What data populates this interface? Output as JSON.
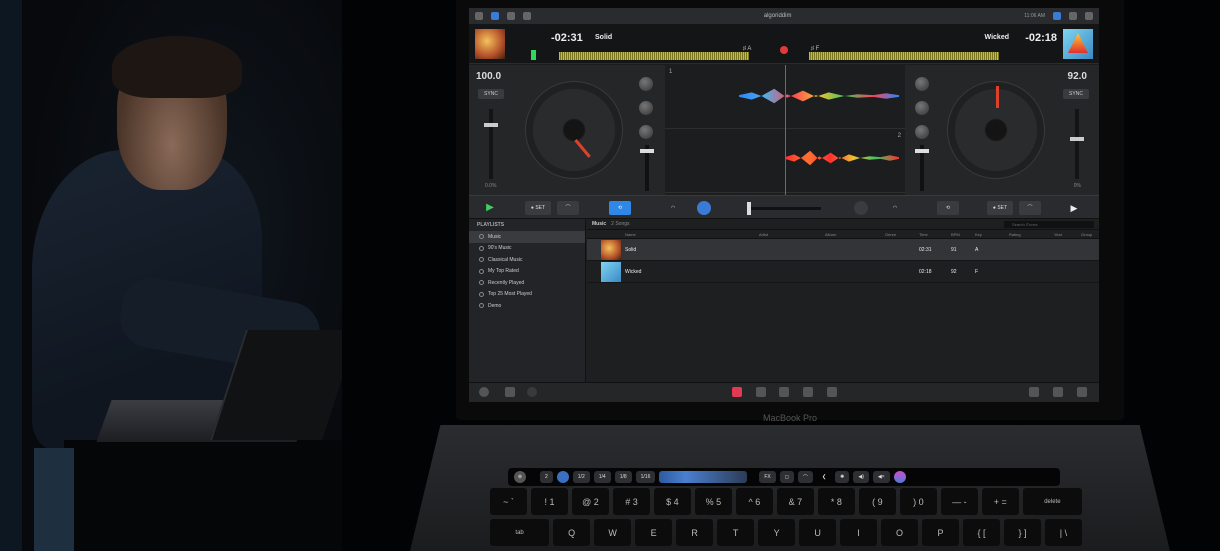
{
  "app": {
    "menubar": {
      "brand": "algoriddim",
      "time": "11:06 AM"
    },
    "deck_a": {
      "time": "-02:31",
      "title": "Solid",
      "key": "A",
      "bpm": "100.0",
      "sync": "SYNC",
      "pitch_value": "0.0%"
    },
    "deck_b": {
      "time": "-02:18",
      "title": "Wicked",
      "key": "F",
      "bpm": "92.0",
      "sync": "SYNC",
      "pitch_value": "0%"
    },
    "lanes": {
      "one": "1",
      "two": "2"
    },
    "transport": {
      "play": "▶",
      "set_a": "● SET",
      "set_b": "● SET"
    },
    "library": {
      "sidebar_header": "PLAYLISTS",
      "sidebar": [
        "Music",
        "90's Music",
        "Classical Music",
        "My Top Rated",
        "Recently Played",
        "Top 25 Most Played",
        "Demo"
      ],
      "crumb": "Music",
      "count": "2 Songs",
      "search_placeholder": "Search iTunes",
      "columns": [
        "Name",
        "Artist",
        "Album",
        "Genre",
        "Time",
        "BPM",
        "Key",
        "Rating",
        "Year",
        "Group"
      ],
      "rows": [
        {
          "name": "Solid",
          "time": "02:31",
          "bpm": "91",
          "key": "A"
        },
        {
          "name": "Wicked",
          "time": "02:18",
          "bpm": "92",
          "key": "F"
        }
      ]
    }
  },
  "laptop_label": "MacBook Pro",
  "touchbar": {
    "esc": "⊗",
    "beats": [
      "2",
      "1/2",
      "1/4",
      "1/8",
      "1/16"
    ],
    "fx": "FX"
  },
  "keyboard": {
    "row1": [
      "~\n`",
      "!\n1",
      "@\n2",
      "#\n3",
      "$\n4",
      "%\n5",
      "^\n6",
      "&\n7",
      "*\n8",
      "(\n9",
      ")\n0",
      "—\n-",
      "+\n=",
      "delete"
    ],
    "row2": [
      "tab",
      "Q",
      "W",
      "E",
      "R",
      "T",
      "Y",
      "U",
      "I",
      "O",
      "P",
      "{\n[",
      "}\n]",
      "|\n\\"
    ]
  },
  "colors": {
    "accent": "#2f88e6",
    "record": "#e23a3a",
    "play": "#3ed160"
  }
}
